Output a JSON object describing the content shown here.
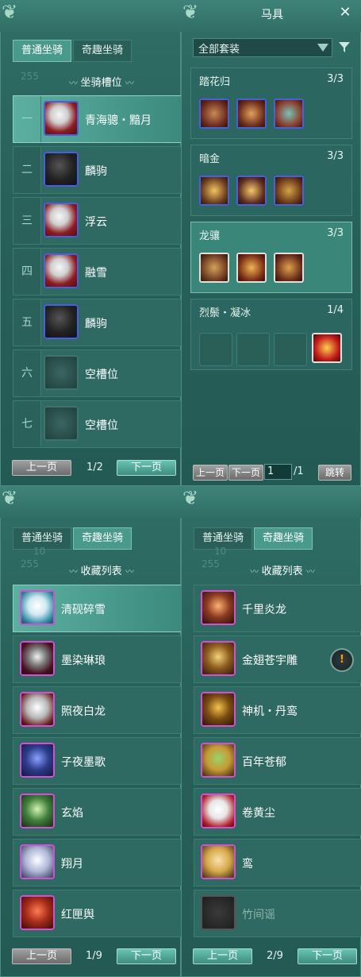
{
  "top": {
    "left": {
      "tabs": [
        "普通坐骑",
        "奇趣坐骑"
      ],
      "active_tab": 0,
      "faint_num": "255",
      "section_title": "坐骑槽位",
      "slots": [
        {
          "index": "一",
          "name": "青海骢・黯月",
          "portrait": "redhorse"
        },
        {
          "index": "二",
          "name": "麟驹",
          "portrait": "blue"
        },
        {
          "index": "三",
          "name": "浮云",
          "portrait": "redhorse"
        },
        {
          "index": "四",
          "name": "融雪",
          "portrait": "redhorse"
        },
        {
          "index": "五",
          "name": "麟驹",
          "portrait": "blue"
        },
        {
          "index": "六",
          "name": "空槽位",
          "portrait": "empty"
        },
        {
          "index": "七",
          "name": "空槽位",
          "portrait": "empty"
        }
      ],
      "prev": "上一页",
      "page": "1/2",
      "next": "下一页"
    },
    "right": {
      "title": "马具",
      "close_icon": "close-icon",
      "filter_select": "全部套装",
      "suits": [
        {
          "name": "踏花归",
          "count": "3/3"
        },
        {
          "name": "暗金",
          "count": "3/3"
        },
        {
          "name": "龙骧",
          "count": "3/3"
        },
        {
          "name": "烈鬃・凝冰",
          "count": "1/4"
        }
      ],
      "prev": "上一页",
      "next": "下一页",
      "page_input": "1",
      "page_total": "/1",
      "jump": "跳转"
    }
  },
  "bottom": {
    "left": {
      "tabs": [
        "普通坐骑",
        "奇趣坐骑"
      ],
      "active_tab": 1,
      "faint_num_top": "10",
      "faint_num": "255",
      "section_title": "收藏列表",
      "items": [
        {
          "name": "清砚碎雪",
          "style": "p-white"
        },
        {
          "name": "墨染琳琅",
          "style": "p-ink"
        },
        {
          "name": "照夜白龙",
          "style": "p-dragon"
        },
        {
          "name": "子夜墨歌",
          "style": "p-blue"
        },
        {
          "name": "玄焰",
          "style": "p-green"
        },
        {
          "name": "翔月",
          "style": "p-wing"
        },
        {
          "name": "红匣舆",
          "style": "p-red"
        }
      ],
      "prev": "上一页",
      "page": "1/9",
      "next": "下一页"
    },
    "right": {
      "tabs": [
        "普通坐骑",
        "奇趣坐骑"
      ],
      "active_tab": 1,
      "faint_num_top": "10",
      "faint_num": "255",
      "section_title": "收藏列表",
      "items": [
        {
          "name": "千里炎龙",
          "style": "p-fire"
        },
        {
          "name": "金翅苍宇雕",
          "style": "p-eagle"
        },
        {
          "name": "神机・丹鸾",
          "style": "p-gun"
        },
        {
          "name": "百年苍郁",
          "style": "p-tree"
        },
        {
          "name": "卷黄尘",
          "style": "p-goose"
        },
        {
          "name": "鸾",
          "style": "p-boot"
        },
        {
          "name": "竹间谣",
          "style": "gray"
        }
      ],
      "warning_icon": "warning-icon",
      "prev": "上一页",
      "page": "2/9",
      "next": "下一页"
    }
  },
  "colors": {
    "panel_bg": "#2f6f66",
    "tab_active": "#4a9a8c",
    "button_green": "#3e8d80",
    "button_gray": "#6c6c6c",
    "accent_pink": "#d34fd3",
    "accent_blue": "#4a5ee0"
  }
}
